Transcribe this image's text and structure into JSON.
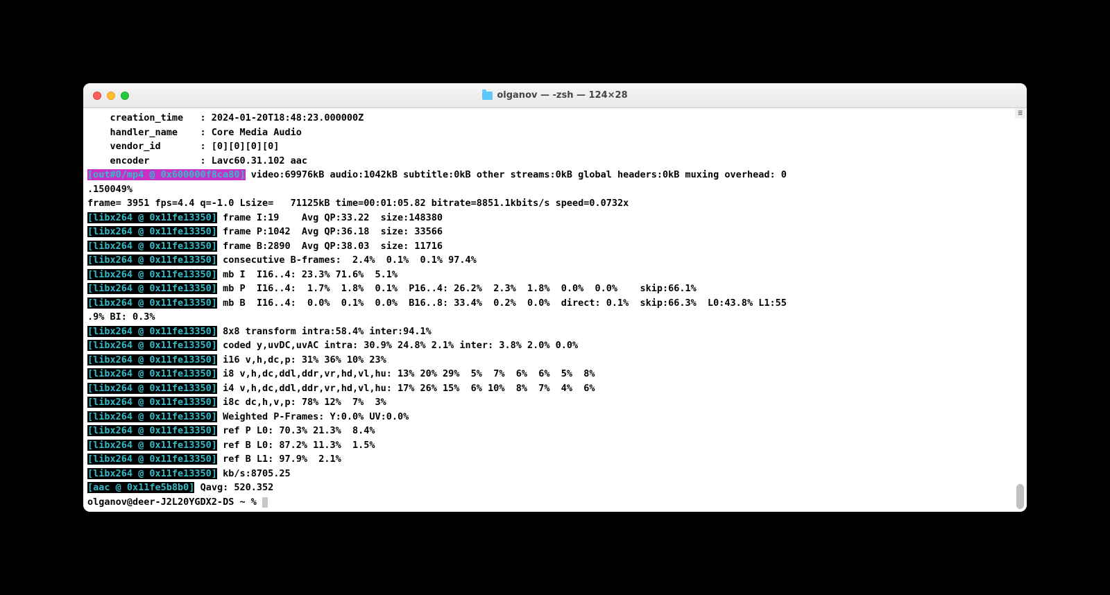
{
  "titlebar": {
    "title": "olganov — -zsh — 124×28"
  },
  "meta": {
    "l1": "    creation_time   : 2024-01-20T18:48:23.000000Z",
    "l2": "    handler_name    : Core Media Audio",
    "l3": "    vendor_id       : [0][0][0][0]",
    "l4": "    encoder         : Lavc60.31.102 aac"
  },
  "out": {
    "tag": "[out#0/mp4 @ 0x600000f8ca80]",
    "tail": " video:69976kB audio:1042kB subtitle:0kB other streams:0kB global headers:0kB muxing overhead: 0",
    "cont": ".150049%"
  },
  "frame": "frame= 3951 fps=4.4 q=-1.0 Lsize=   71125kB time=00:01:05.82 bitrate=8851.1kbits/s speed=0.0732x    ",
  "libx": {
    "tag": "[libx264 @ 0x11fe13350]",
    "l1": " frame I:19    Avg QP:33.22  size:148380",
    "l2": " frame P:1042  Avg QP:36.18  size: 33566",
    "l3": " frame B:2890  Avg QP:38.03  size: 11716",
    "l4": " consecutive B-frames:  2.4%  0.1%  0.1% 97.4%",
    "l5": " mb I  I16..4: 23.3% 71.6%  5.1%",
    "l6": " mb P  I16..4:  1.7%  1.8%  0.1%  P16..4: 26.2%  2.3%  1.8%  0.0%  0.0%    skip:66.1%",
    "l7": " mb B  I16..4:  0.0%  0.1%  0.0%  B16..8: 33.4%  0.2%  0.0%  direct: 0.1%  skip:66.3%  L0:43.8% L1:55",
    "l7cont": ".9% BI: 0.3%",
    "l8": " 8x8 transform intra:58.4% inter:94.1%",
    "l9": " coded y,uvDC,uvAC intra: 30.9% 24.8% 2.1% inter: 3.8% 2.0% 0.0%",
    "l10": " i16 v,h,dc,p: 31% 36% 10% 23%",
    "l11": " i8 v,h,dc,ddl,ddr,vr,hd,vl,hu: 13% 20% 29%  5%  7%  6%  6%  5%  8%",
    "l12": " i4 v,h,dc,ddl,ddr,vr,hd,vl,hu: 17% 26% 15%  6% 10%  8%  7%  4%  6%",
    "l13": " i8c dc,h,v,p: 78% 12%  7%  3%",
    "l14": " Weighted P-Frames: Y:0.0% UV:0.0%",
    "l15": " ref P L0: 70.3% 21.3%  8.4%",
    "l16": " ref B L0: 87.2% 11.3%  1.5%",
    "l17": " ref B L1: 97.9%  2.1%",
    "l18": " kb/s:8705.25"
  },
  "aac": {
    "tag": "[aac @ 0x11fe5b8b0]",
    "text": " Qavg: 520.352"
  },
  "prompt": "olganov@deer-J2L20YGDX2-DS ~ % "
}
